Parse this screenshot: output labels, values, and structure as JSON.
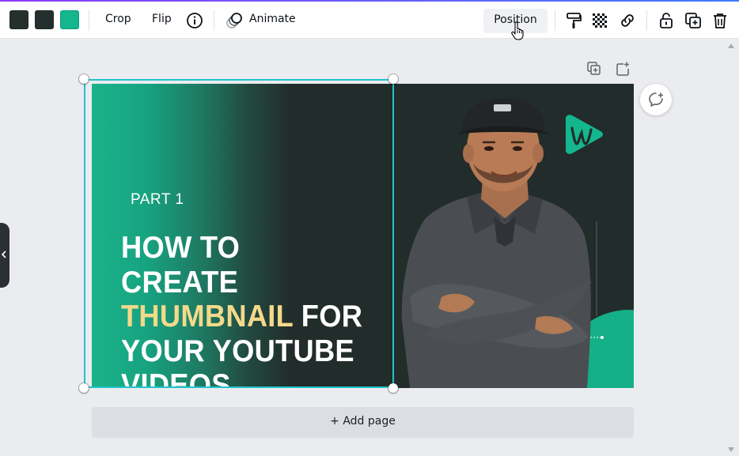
{
  "toolbar": {
    "swatches": [
      {
        "name": "color-swatch-1",
        "color": "#25302e"
      },
      {
        "name": "color-swatch-2",
        "color": "#25302e"
      },
      {
        "name": "color-swatch-3",
        "color": "#14b68e"
      }
    ],
    "crop_label": "Crop",
    "flip_label": "Flip",
    "animate_label": "Animate",
    "position_label": "Position",
    "icons": [
      "info-icon",
      "animate-icon",
      "paint-roller-icon",
      "transparency-icon",
      "link-icon",
      "lock-icon",
      "duplicate-icon",
      "trash-icon"
    ]
  },
  "page_actions": {
    "icons": [
      "duplicate-page-icon",
      "add-page-icon"
    ]
  },
  "design": {
    "part_text": "PART 1",
    "headline_line1": "HOW TO CREATE",
    "headline_highlight": "THUMBNAIL",
    "headline_line2_rest": " FOR",
    "headline_line3": "YOUR YOUTUBE",
    "headline_line4": "VIDEOS",
    "colors": {
      "accent_green": "#14b68e",
      "dark_bg": "#222c2a",
      "highlight_yellow": "#f5d98a",
      "selection": "#20c4cb"
    }
  },
  "add_page_label": "+ Add page"
}
